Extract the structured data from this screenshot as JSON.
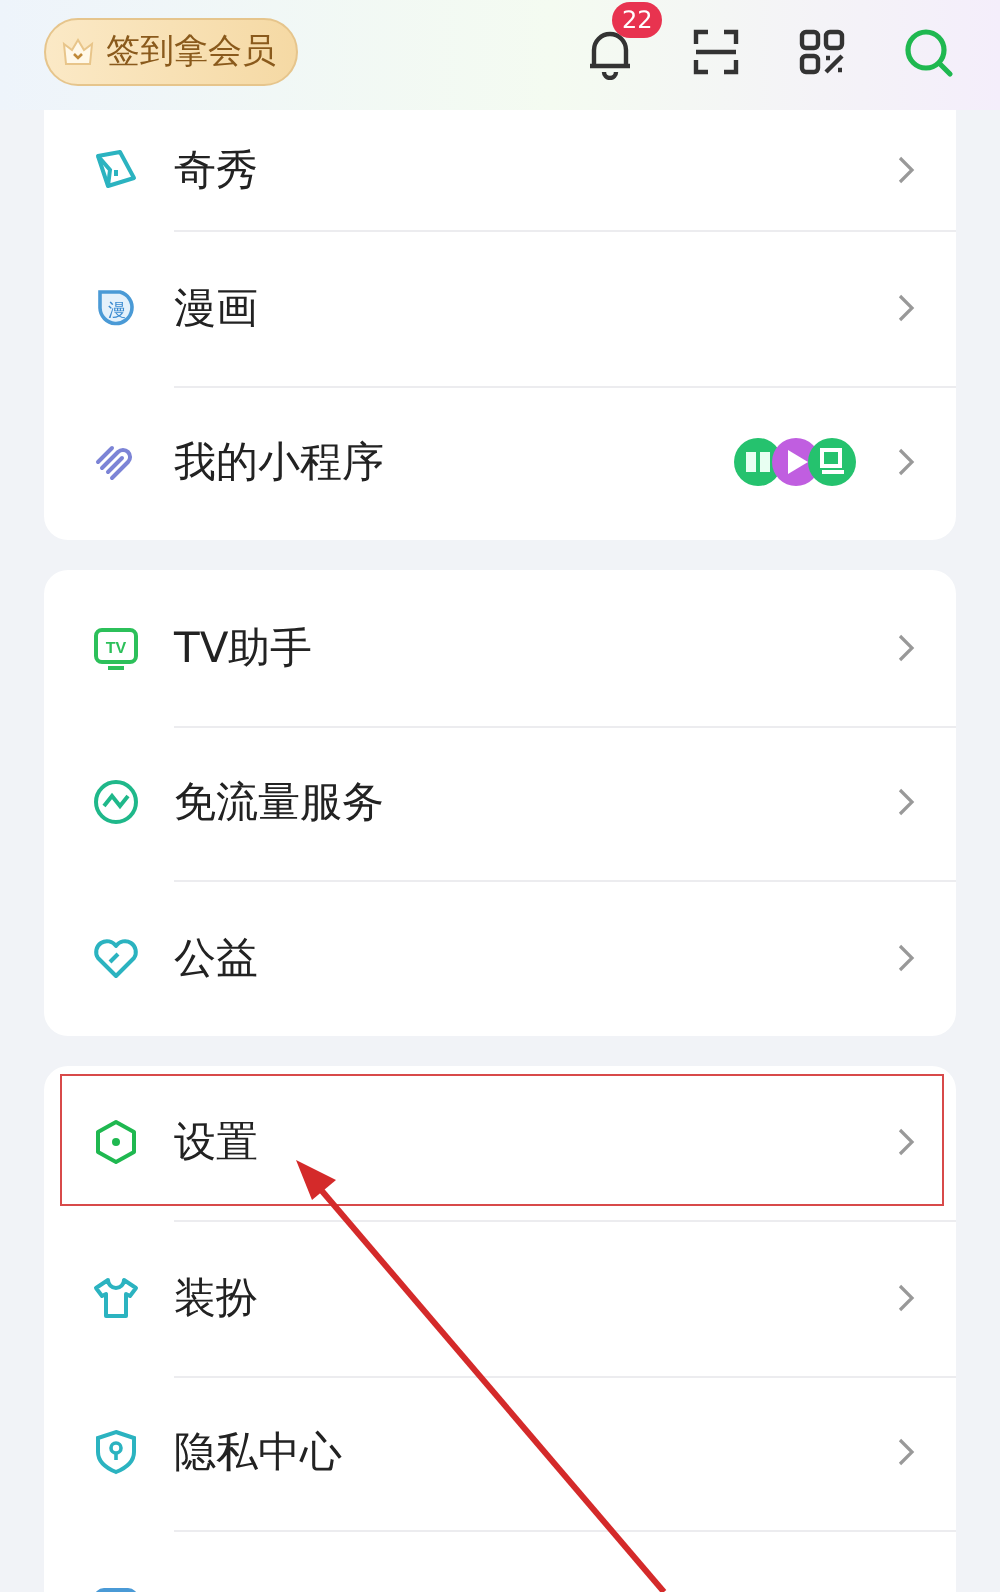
{
  "header": {
    "member_button": "签到拿会员",
    "notification_count": "22"
  },
  "sections": [
    {
      "items": [
        {
          "kind": "plain",
          "label": "奇秀",
          "highlighted": false
        },
        {
          "kind": "plain",
          "label": "漫画",
          "icon_text": "漫",
          "highlighted": false
        },
        {
          "kind": "apps",
          "label": "我的小程序",
          "highlighted": false
        }
      ]
    },
    {
      "items": [
        {
          "kind": "plain",
          "label": "TV助手",
          "icon_text": "TV",
          "highlighted": false
        },
        {
          "kind": "plain",
          "label": "免流量服务",
          "highlighted": false
        },
        {
          "kind": "plain",
          "label": "公益",
          "highlighted": false
        }
      ]
    },
    {
      "items": [
        {
          "kind": "plain",
          "label": "设置",
          "highlighted": true
        },
        {
          "kind": "plain",
          "label": "装扮",
          "highlighted": false
        },
        {
          "kind": "plain",
          "label": "隐私中心",
          "highlighted": false
        },
        {
          "kind": "partial",
          "highlighted": false
        }
      ]
    }
  ]
}
